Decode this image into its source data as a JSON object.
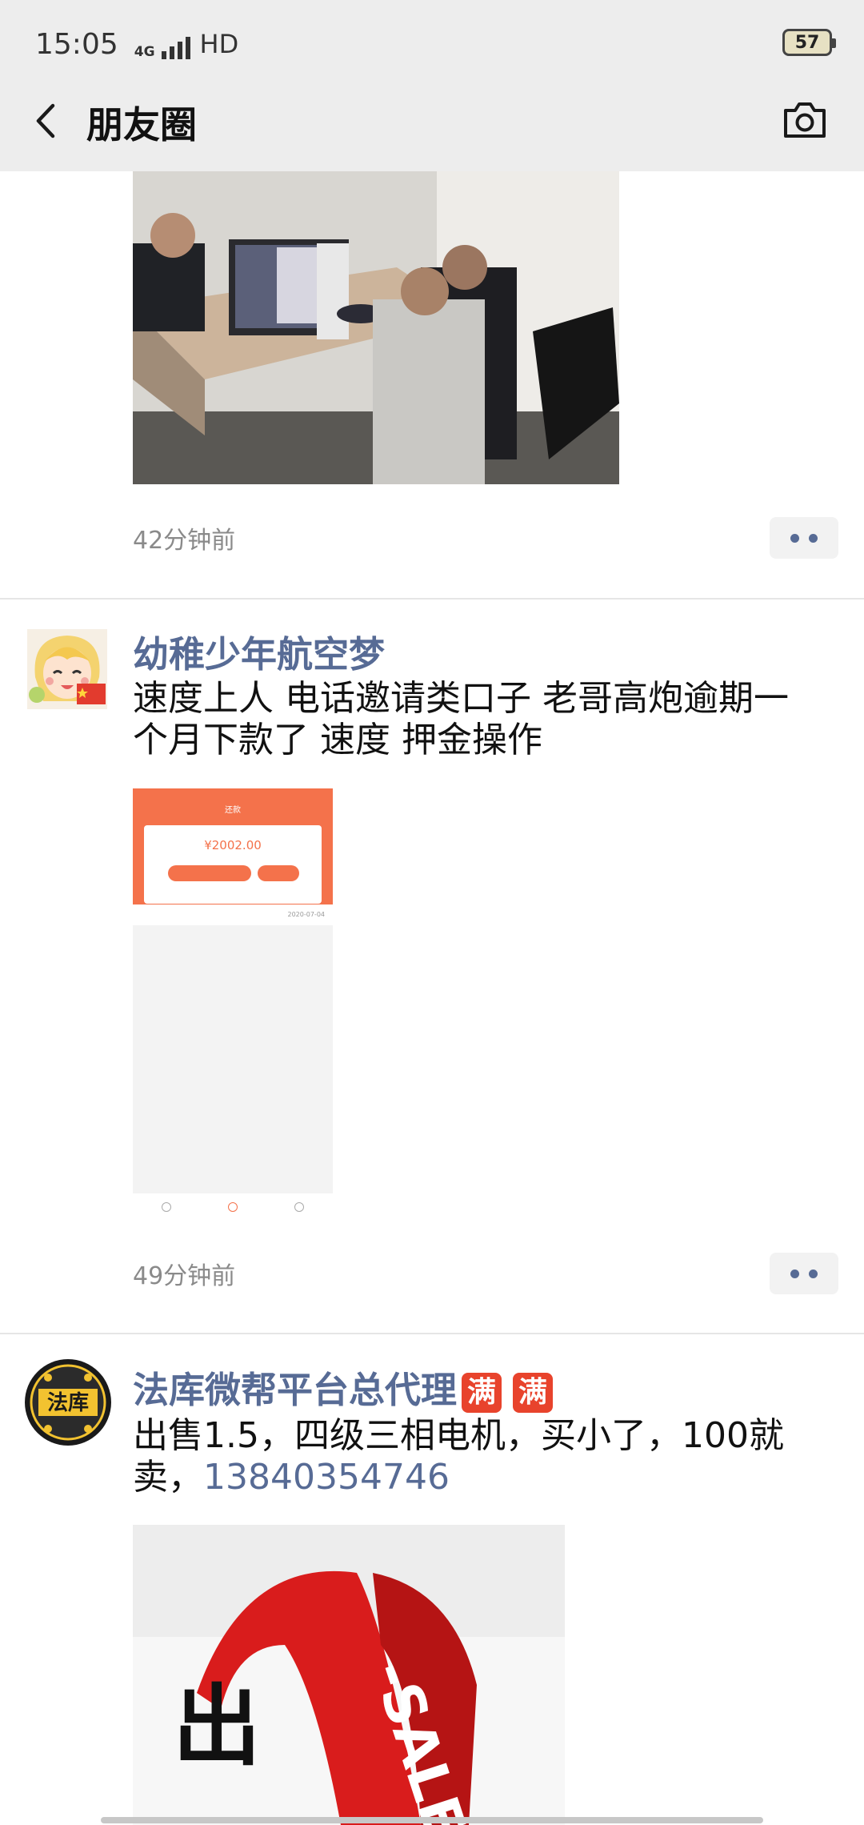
{
  "status_bar": {
    "time": "15:05",
    "network": "4G",
    "signal_label": "HD",
    "battery": "57"
  },
  "header": {
    "title": "朋友圈"
  },
  "posts": [
    {
      "time_ago": "42分钟前"
    },
    {
      "author": "幼稚少年航空梦",
      "text": "速度上人  电话邀请类口子  老哥高炮逾期一个月下款了  速度 押金操作",
      "image": {
        "screen_title": "还款",
        "amount": "¥2002.00",
        "date": "2020-07-04"
      },
      "time_ago": "49分钟前"
    },
    {
      "author": "法库微帮平台总代理",
      "badges": [
        "满",
        "满"
      ],
      "text": "出售1.5，四级三相电机，买小了，100就卖，",
      "phone": "13840354746",
      "image": {
        "text_left": "出",
        "ribbon_text": "-SALE"
      },
      "avatar_text": "法库"
    }
  ],
  "colors": {
    "link": "#576b95",
    "header_bg": "#ededed",
    "accent_badge": "#e8432c"
  }
}
